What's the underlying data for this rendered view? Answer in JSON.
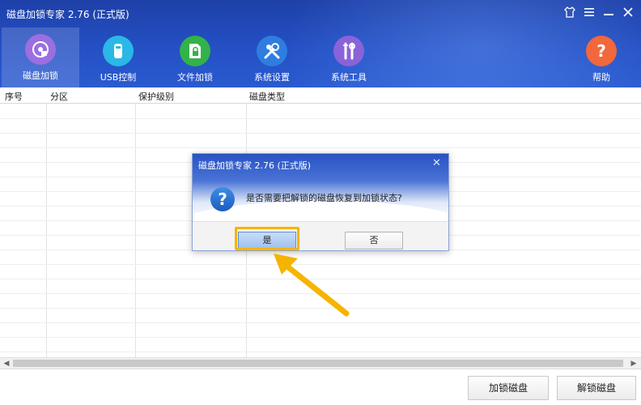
{
  "window": {
    "title": "磁盘加锁专家 2.76  (正式版)",
    "controls": [
      "skin-icon",
      "menu-icon",
      "minimize-icon",
      "close-icon"
    ]
  },
  "toolbar": {
    "items": [
      {
        "label": "磁盘加锁",
        "icon": "disk-lock-icon",
        "active": true
      },
      {
        "label": "USB控制",
        "icon": "usb-icon",
        "active": false
      },
      {
        "label": "文件加锁",
        "icon": "file-lock-icon",
        "active": false
      },
      {
        "label": "系统设置",
        "icon": "settings-tools-icon",
        "active": false
      },
      {
        "label": "系统工具",
        "icon": "system-tools-icon",
        "active": false
      },
      {
        "label": "帮助",
        "icon": "help-icon",
        "active": false
      }
    ]
  },
  "table": {
    "columns": [
      "序号",
      "分区",
      "保护级别",
      "磁盘类型"
    ],
    "rows": []
  },
  "footer": {
    "lock_label": "加锁磁盘",
    "unlock_label": "解锁磁盘"
  },
  "dialog": {
    "title": "磁盘加锁专家 2.76  (正式版)",
    "message": "是否需要把解锁的磁盘恢复到加锁状态?",
    "yes_label": "是",
    "no_label": "否",
    "icon": "question-icon"
  },
  "colors": {
    "header": "#2450c4",
    "highlight": "#f5b400",
    "annotation_arrow": "#f5b400"
  }
}
